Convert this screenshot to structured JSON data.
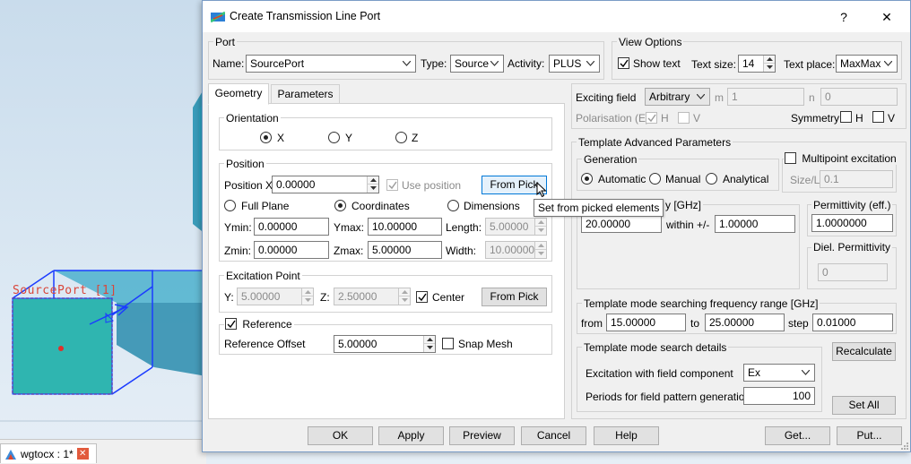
{
  "dialog": {
    "title": "Create Transmission Line Port",
    "help_glyph": "?",
    "close_glyph": "✕"
  },
  "port": {
    "group_label": "Port",
    "name_label": "Name:",
    "name_value": "SourcePort",
    "type_label": "Type:",
    "type_value": "Source",
    "activity_label": "Activity:",
    "activity_value": "PLUS"
  },
  "view_options": {
    "group_label": "View Options",
    "show_text_label": "Show text",
    "show_text_checked": true,
    "text_size_label": "Text size:",
    "text_size_value": "14",
    "text_place_label": "Text place:",
    "text_place_value": "MaxMax"
  },
  "tabs": [
    {
      "label": "Geometry",
      "active": true
    },
    {
      "label": "Parameters",
      "active": false
    }
  ],
  "geometry": {
    "orientation": {
      "group_label": "Orientation",
      "options": [
        "X",
        "Y",
        "Z"
      ],
      "selected": "X"
    },
    "position": {
      "group_label": "Position",
      "position_x_label": "Position X",
      "position_x_value": "0.00000",
      "use_position_label": "Use position",
      "from_pick_label": "From Pick",
      "modes": [
        "Full Plane",
        "Coordinates",
        "Dimensions"
      ],
      "selected_mode": "Coordinates",
      "ymin_label": "Ymin:",
      "ymin_value": "0.00000",
      "ymax_label": "Ymax:",
      "ymax_value": "10.00000",
      "length_label": "Length:",
      "length_value": "5.00000",
      "zmin_label": "Zmin:",
      "zmin_value": "0.00000",
      "zmax_label": "Zmax:",
      "zmax_value": "5.00000",
      "width_label": "Width:",
      "width_value": "10.00000"
    },
    "excitation_point": {
      "group_label": "Excitation Point",
      "y_label": "Y:",
      "y_value": "5.00000",
      "z_label": "Z:",
      "z_value": "2.50000",
      "center_label": "Center",
      "center_checked": true,
      "from_pick_label": "From Pick"
    },
    "reference": {
      "label": "Reference",
      "checked": true,
      "offset_label": "Reference Offset",
      "offset_value": "5.00000",
      "snap_mesh_label": "Snap Mesh",
      "snap_mesh_checked": false
    }
  },
  "tooltip": "Set from picked elements",
  "exciting": {
    "exciting_field_label": "Exciting field",
    "exciting_field_value": "Arbitrary",
    "m_label": "m",
    "m_value": "1",
    "n_label": "n",
    "n_value": "0",
    "polarisation_label": "Polarisation (E)",
    "h_label": "H",
    "v_label": "V",
    "symmetry_label": "Symmetry"
  },
  "template_advanced": {
    "group_label": "Template Advanced Parameters",
    "generation_label": "Generation",
    "generation_options": [
      "Automatic",
      "Manual",
      "Analytical"
    ],
    "generation_selected": "Automatic",
    "multipoint_label": "Multipoint excitation",
    "multipoint_checked": false,
    "size_l_label": "Size/L",
    "size_l_value": "0.1",
    "frequency_tail": "y [GHz]",
    "frequency_value": "20.00000",
    "within_label": "within +/-",
    "within_value": "1.00000",
    "permittivity_label": "Permittivity (eff.)",
    "permittivity_value": "1.0000000",
    "diel_permittivity_label": "Diel. Permittivity",
    "diel_permittivity_value": "0"
  },
  "search_range": {
    "group_label": "Template mode searching frequency range [GHz]",
    "from_label": "from",
    "from_value": "15.00000",
    "to_label": "to",
    "to_value": "25.00000",
    "step_label": "step",
    "step_value": "0.01000"
  },
  "search_details": {
    "group_label": "Template mode search details",
    "excitation_label": "Excitation with field component",
    "excitation_value": "Ex",
    "periods_label": "Periods for field pattern generation",
    "periods_value": "100"
  },
  "side_buttons": {
    "recalculate": "Recalculate",
    "set_all": "Set All"
  },
  "footer_buttons": [
    "OK",
    "Apply",
    "Preview",
    "Cancel",
    "Help",
    "Get...",
    "Put..."
  ],
  "viewport": {
    "port_label": "SourcePort [1]"
  },
  "taskbar": {
    "tab_label": "wgtocx : 1*",
    "close_glyph": "✕"
  },
  "colors": {
    "accent": "#0078d7",
    "model_fill": "#2fb5b0",
    "port_label": "#d9463a"
  }
}
